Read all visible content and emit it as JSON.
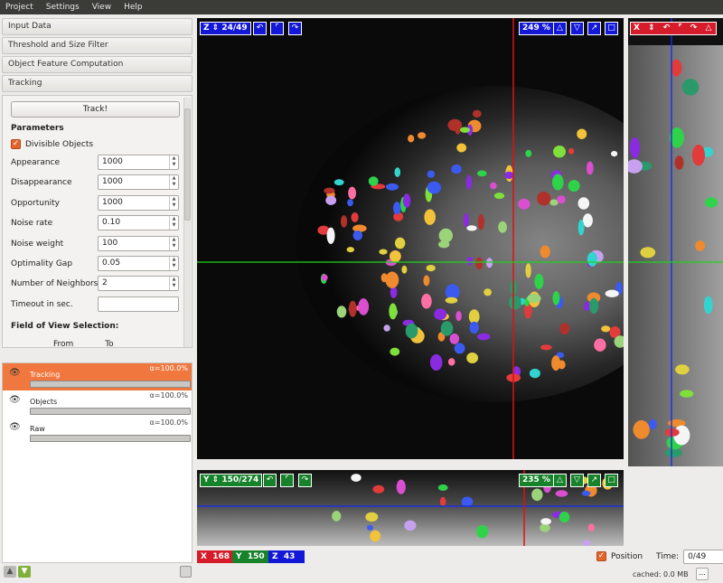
{
  "menu": [
    "Project",
    "Settings",
    "View",
    "Help"
  ],
  "applets": [
    "Input Data",
    "Threshold and Size Filter",
    "Object Feature Computation",
    "Tracking"
  ],
  "tracking": {
    "track_button": "Track!",
    "parameters_label": "Parameters",
    "divisible_label": "Divisible Objects",
    "divisible_checked": true,
    "params": [
      {
        "label": "Appearance",
        "value": "1000"
      },
      {
        "label": "Disappearance",
        "value": "1000"
      },
      {
        "label": "Opportunity",
        "value": "1000"
      },
      {
        "label": "Noise rate",
        "value": "0.10"
      },
      {
        "label": "Noise weight",
        "value": "100"
      },
      {
        "label": "Optimality Gap",
        "value": "0.05"
      },
      {
        "label": "Number of Neighbors",
        "value": "2"
      },
      {
        "label": "Timeout in sec.",
        "value": ""
      }
    ],
    "fov_label": "Field of View Selection:",
    "from_label": "From",
    "to_label": "To"
  },
  "layers": [
    {
      "name": "Tracking",
      "alpha": "α=100.0%",
      "selected": true,
      "opacity": 1.0
    },
    {
      "name": "Objects",
      "alpha": "α=100.0%",
      "selected": false,
      "opacity": 1.0
    },
    {
      "name": "Raw",
      "alpha": "α=100.0%",
      "selected": false,
      "opacity": 1.0
    }
  ],
  "viewers": {
    "main": {
      "axis": "Z",
      "slice": "24/49",
      "zoom": "249 %"
    },
    "bottom": {
      "axis": "Y",
      "slice": "150/274",
      "zoom": "235 %"
    },
    "side_label": "X"
  },
  "status": {
    "x": {
      "label": "X",
      "value": "168",
      "color": "#d61c2a"
    },
    "y": {
      "label": "Y",
      "value": "150",
      "color": "#16822a"
    },
    "z": {
      "label": "Z",
      "value": "43",
      "color": "#1217d8"
    },
    "position_label": "Position",
    "position_checked": true,
    "time_label": "Time:",
    "time_value": "0/49",
    "cached": "cached: 0.0 MB",
    "dots": "..."
  },
  "colors": {
    "accent": "#f0783f",
    "crosshair_v": "#e01010",
    "crosshair_h": "#18d818",
    "crosshair_blue": "#1a2ee0"
  }
}
